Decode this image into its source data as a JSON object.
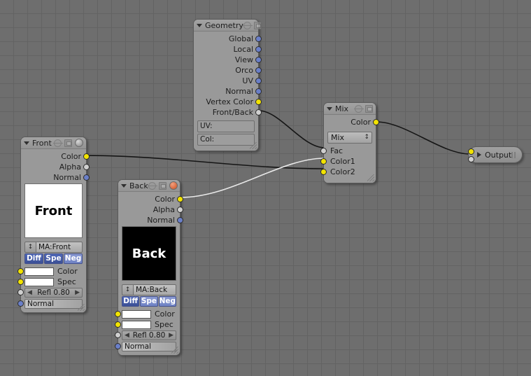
{
  "editor": {
    "name": "blender-node-editor",
    "background_color": "#6e6e6e",
    "grid_color": "#636363"
  },
  "socket_colors": {
    "vector": "#6a7fc8",
    "color": "#f2e302",
    "value": "#cfcfcf"
  },
  "nodes": {
    "geometry": {
      "title": "Geometry",
      "outputs": [
        {
          "label": "Global",
          "type": "vector"
        },
        {
          "label": "Local",
          "type": "vector"
        },
        {
          "label": "View",
          "type": "vector"
        },
        {
          "label": "Orco",
          "type": "vector"
        },
        {
          "label": "UV",
          "type": "vector"
        },
        {
          "label": "Normal",
          "type": "vector"
        },
        {
          "label": "Vertex Color",
          "type": "color"
        },
        {
          "label": "Front/Back",
          "type": "value"
        }
      ],
      "fields": [
        {
          "label": "UV:",
          "value": ""
        },
        {
          "label": "Col:",
          "value": ""
        }
      ],
      "header_icons": [
        "node-icon",
        "preview-icon"
      ]
    },
    "front": {
      "title": "Front",
      "outputs": [
        {
          "label": "Color",
          "type": "color"
        },
        {
          "label": "Alpha",
          "type": "value"
        },
        {
          "label": "Normal",
          "type": "vector"
        }
      ],
      "preview_text": "Front",
      "preview_bg": "#ffffff",
      "preview_fg": "#000000",
      "material_name": "MA:Front",
      "toggles": [
        {
          "label": "Diff",
          "active": true
        },
        {
          "label": "Spe",
          "active": true
        },
        {
          "label": "Neg",
          "active": false
        }
      ],
      "inputs": [
        {
          "label": "Color",
          "type": "color",
          "widget": "swatch",
          "value": "#ffffff"
        },
        {
          "label": "Spec",
          "type": "color",
          "widget": "swatch",
          "value": "#ffffff"
        },
        {
          "label": "Refl 0.80",
          "type": "value",
          "widget": "number"
        },
        {
          "label": "Normal",
          "type": "vector",
          "widget": "button"
        }
      ],
      "header_icons": [
        "node-icon",
        "preview-icon",
        "material-ball-white"
      ]
    },
    "back": {
      "title": "Back",
      "outputs": [
        {
          "label": "Color",
          "type": "color"
        },
        {
          "label": "Alpha",
          "type": "value"
        },
        {
          "label": "Normal",
          "type": "vector"
        }
      ],
      "preview_text": "Back",
      "preview_bg": "#000000",
      "preview_fg": "#ffffff",
      "material_name": "MA:Back",
      "toggles": [
        {
          "label": "Diff",
          "active": true
        },
        {
          "label": "Spe",
          "active": false
        },
        {
          "label": "Neg",
          "active": false
        }
      ],
      "inputs": [
        {
          "label": "Color",
          "type": "color",
          "widget": "swatch",
          "value": "#ffffff"
        },
        {
          "label": "Spec",
          "type": "color",
          "widget": "swatch",
          "value": "#ffffff"
        },
        {
          "label": "Refl 0.80",
          "type": "value",
          "widget": "number"
        },
        {
          "label": "Normal",
          "type": "vector",
          "widget": "button"
        }
      ],
      "header_icons": [
        "node-icon",
        "preview-icon",
        "material-ball-orange"
      ]
    },
    "mix": {
      "title": "Mix",
      "outputs": [
        {
          "label": "Color",
          "type": "color"
        }
      ],
      "blend_mode": "Mix",
      "inputs": [
        {
          "label": "Fac",
          "type": "value"
        },
        {
          "label": "Color1",
          "type": "color"
        },
        {
          "label": "Color2",
          "type": "color"
        }
      ],
      "header_icons": [
        "node-icon",
        "preview-icon"
      ]
    },
    "output": {
      "title": "Output",
      "collapsed": true,
      "inputs": [
        {
          "label": "Color",
          "type": "color"
        },
        {
          "label": "Alpha",
          "type": "value"
        }
      ]
    }
  },
  "links": [
    {
      "from": "geometry.Front/Back",
      "to": "mix.Fac",
      "color": "#151515"
    },
    {
      "from": "front.Color",
      "to": "mix.Color2",
      "color": "#151515"
    },
    {
      "from": "back.Color",
      "to": "mix.Color1",
      "color": "#e8e8e8"
    },
    {
      "from": "mix.Color",
      "to": "output.Color",
      "color": "#151515"
    }
  ]
}
